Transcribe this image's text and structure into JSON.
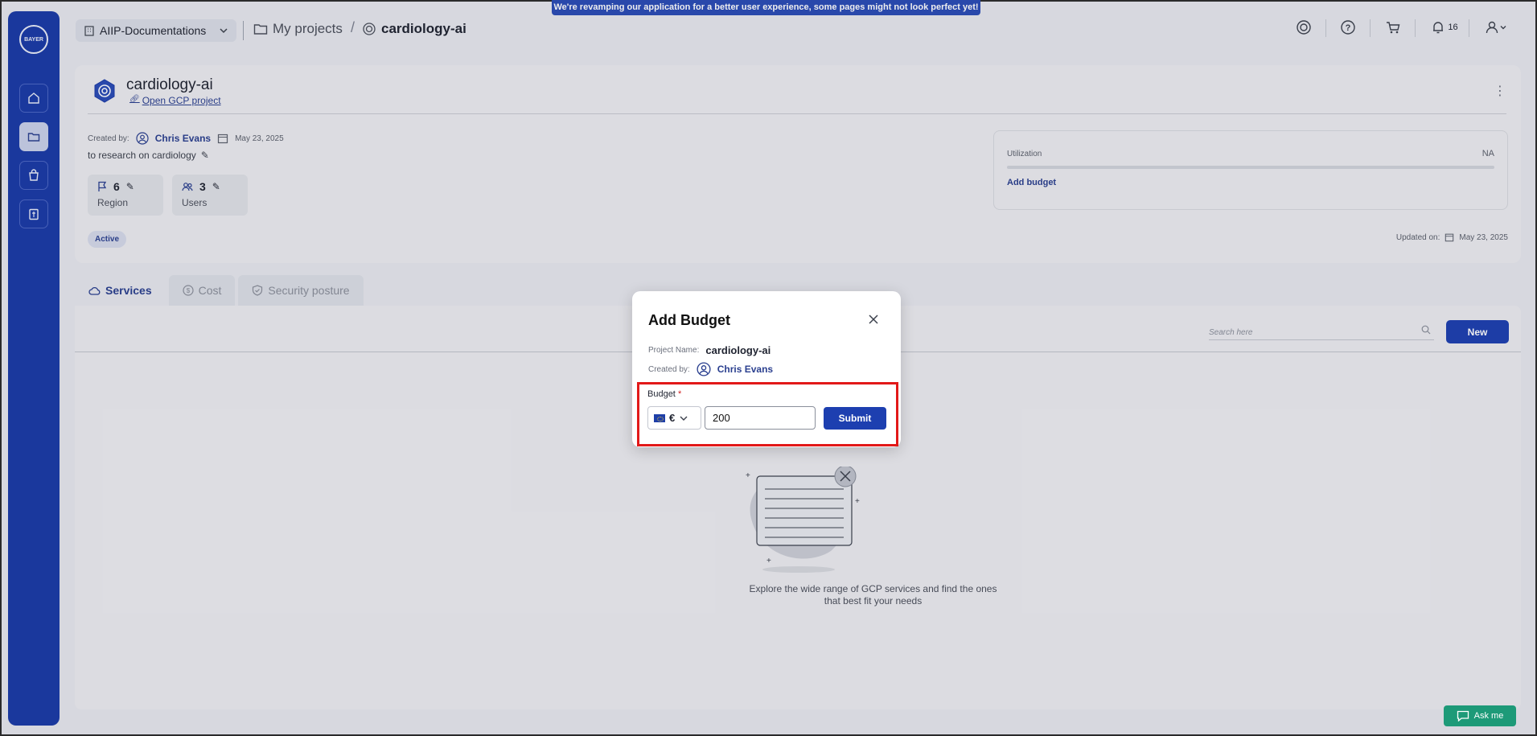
{
  "banner": "We're revamping our application for a better user experience, some pages might not look perfect yet!",
  "org_select": {
    "value": "AIIP-Documentations"
  },
  "breadcrumb": {
    "root": "My projects",
    "separator": "/",
    "current": "cardiology-ai"
  },
  "notifications": {
    "count": "16"
  },
  "project": {
    "title": "cardiology-ai",
    "gcp_link": "Open GCP project",
    "created_by_label": "Created by:",
    "created_by": "Chris Evans",
    "created_date": "May 23, 2025",
    "description": "to research on cardiology",
    "region": {
      "count": "6",
      "label": "Region"
    },
    "users": {
      "count": "3",
      "label": "Users"
    },
    "status": "Active",
    "utilization_label": "Utilization",
    "utilization_value": "NA",
    "add_budget": "Add budget",
    "updated_label": "Updated on:",
    "updated_date": "May 23, 2025"
  },
  "tabs": [
    {
      "label": "Services"
    },
    {
      "label": "Cost"
    },
    {
      "label": "Security posture"
    }
  ],
  "services": {
    "search_placeholder": "Search here",
    "new_button": "New",
    "empty_line1": "Explore the wide range of GCP services and find the ones",
    "empty_line2": "that best fit your needs"
  },
  "modal": {
    "title": "Add Budget",
    "project_name_label": "Project Name:",
    "project_name": "cardiology-ai",
    "created_by_label": "Created by:",
    "created_by": "Chris Evans",
    "budget_label": "Budget",
    "required_mark": "*",
    "currency_symbol": "€",
    "budget_value": "200",
    "submit": "Submit"
  },
  "ask_me": "Ask me",
  "colors": {
    "primary": "#1d3fb0",
    "sidebar": "#1a3aa6",
    "highlight": "#e21919",
    "askme": "#1d9a78"
  }
}
